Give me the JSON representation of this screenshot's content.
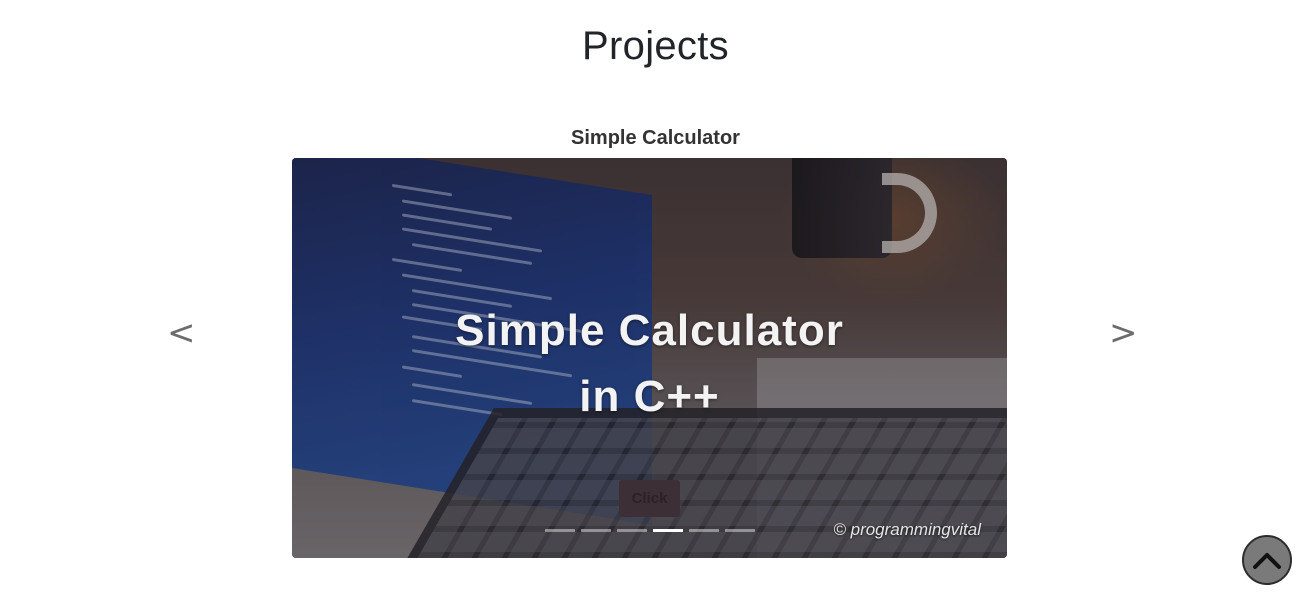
{
  "section": {
    "title": "Projects"
  },
  "carousel": {
    "slide_title": "Simple Calculator",
    "image_caption_line1": "Simple Calculator",
    "image_caption_line2": "in C++",
    "image_watermark": "© programmingvital",
    "button_label": "Click",
    "prev_label": "<",
    "next_label": ">",
    "indicator_count": 6,
    "active_indicator": 4
  },
  "icons": {
    "scroll_top": "chevron-up-icon"
  }
}
